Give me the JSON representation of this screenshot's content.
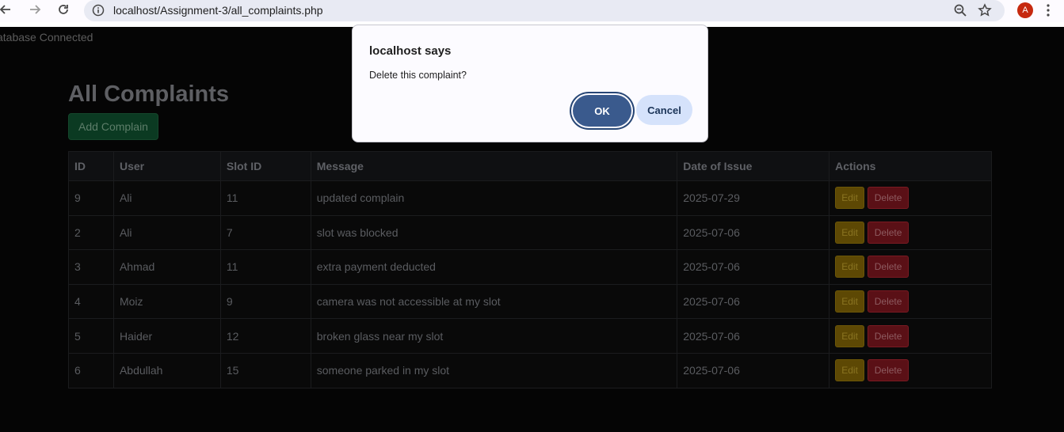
{
  "browser": {
    "url": "localhost/Assignment-3/all_complaints.php",
    "avatar_letter": "A",
    "icons": [
      "back-icon",
      "forward-icon",
      "reload-icon",
      "site-info-icon",
      "zoom-icon",
      "bookmark-star-icon",
      "menu-dots-icon"
    ]
  },
  "page": {
    "db_status": "atabase Connected",
    "title": "All Complaints",
    "add_button": "Add Complain"
  },
  "table": {
    "headers": [
      "ID",
      "User",
      "Slot ID",
      "Message",
      "Date of Issue",
      "Actions"
    ],
    "rows": [
      {
        "id": "9",
        "user": "Ali",
        "slot": "11",
        "message": "updated complain",
        "date": "2025-07-29"
      },
      {
        "id": "2",
        "user": "Ali",
        "slot": "7",
        "message": "slot was blocked",
        "date": "2025-07-06"
      },
      {
        "id": "3",
        "user": "Ahmad",
        "slot": "11",
        "message": "extra payment deducted",
        "date": "2025-07-06"
      },
      {
        "id": "4",
        "user": "Moiz",
        "slot": "9",
        "message": "camera was not accessible at my slot",
        "date": "2025-07-06"
      },
      {
        "id": "5",
        "user": "Haider",
        "slot": "12",
        "message": "broken glass near my slot",
        "date": "2025-07-06"
      },
      {
        "id": "6",
        "user": "Abdullah",
        "slot": "15",
        "message": "someone parked in my slot",
        "date": "2025-07-06"
      }
    ],
    "edit_label": "Edit",
    "delete_label": "Delete"
  },
  "dialog": {
    "title": "localhost says",
    "message": "Delete this complaint?",
    "ok_label": "OK",
    "cancel_label": "Cancel"
  },
  "colors": {
    "page_bg": "#050505",
    "accent": "#3a5a8d",
    "edit": "#5d4804",
    "delete": "#5a1016",
    "add": "#0b3a22"
  }
}
